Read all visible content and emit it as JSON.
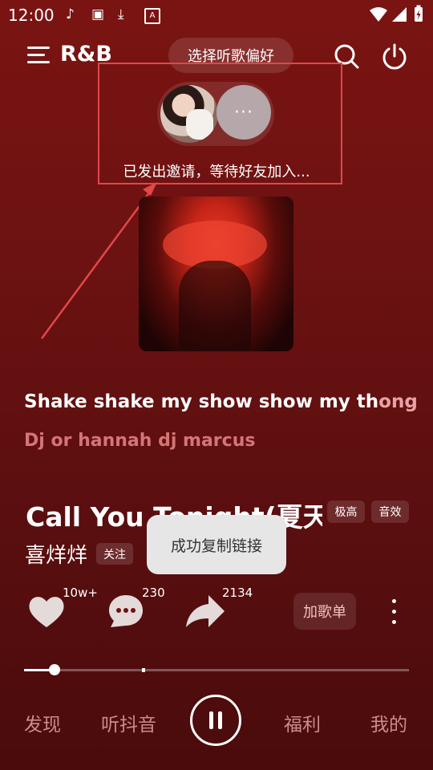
{
  "status_bar": {
    "time": "12:00",
    "icons": [
      "tiktok-icon",
      "image-icon",
      "download-icon",
      "font-icon",
      "wifi-icon",
      "signal-icon",
      "battery-icon"
    ]
  },
  "header": {
    "title": "R&B",
    "preference_button": "选择听歌偏好"
  },
  "invite": {
    "status_text": "已发出邀请，等待好友加入...",
    "more_label": "···"
  },
  "lyrics": {
    "current_bright": "Shake shake my show show my th",
    "current_faded": "ong",
    "next": "Dj or hannah dj marcus"
  },
  "song": {
    "title": "Call You Tonight(夏天的",
    "quality_tag": "极高",
    "effect_tag": "音效",
    "artist": "喜烊烊",
    "follow_label": "关注"
  },
  "toast": "成功复制链接",
  "actions": {
    "like_count": "10w+",
    "comment_count": "230",
    "share_count": "2134",
    "add_playlist": "加歌单"
  },
  "progress": {
    "played_fraction": 0.08,
    "buffered_fraction": 0.31
  },
  "nav": {
    "discover": "发现",
    "listen_douyin": "听抖音",
    "welfare": "福利",
    "mine": "我的"
  },
  "colors": {
    "background": "#6e1212",
    "highlight_box": "#e0484a",
    "lyric_next": "#d47577",
    "nav_text": "#c98c8d"
  }
}
